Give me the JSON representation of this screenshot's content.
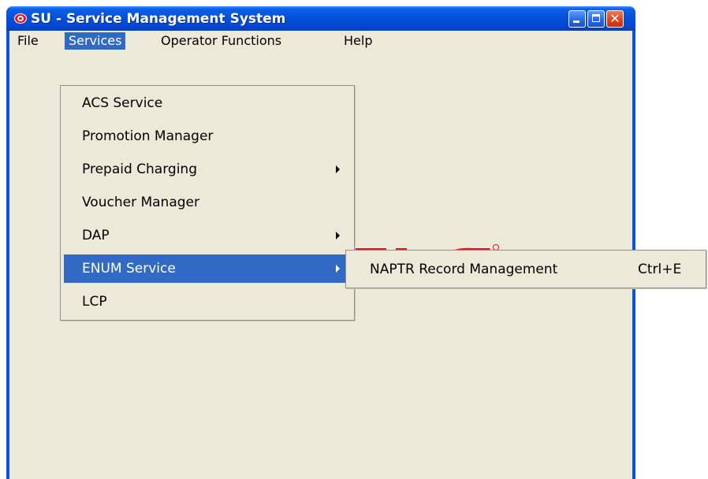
{
  "window": {
    "title": "SU - Service Management System"
  },
  "menubar": {
    "items": [
      {
        "label": "File"
      },
      {
        "label": "Services"
      },
      {
        "label": "Operator Functions"
      },
      {
        "label": "Help"
      }
    ]
  },
  "services_menu": {
    "items": [
      {
        "label": "ACS Service",
        "submenu": false
      },
      {
        "label": "Promotion Manager",
        "submenu": false
      },
      {
        "label": "Prepaid Charging",
        "submenu": true
      },
      {
        "label": "Voucher Manager",
        "submenu": false
      },
      {
        "label": "DAP",
        "submenu": true
      },
      {
        "label": "ENUM Service",
        "submenu": true,
        "highlighted": true
      },
      {
        "label": "LCP",
        "submenu": false
      }
    ]
  },
  "enum_submenu": {
    "items": [
      {
        "label": "NAPTR Record Management",
        "shortcut": "Ctrl+E"
      }
    ]
  },
  "colors": {
    "titlebar": "#0450d8",
    "menu_highlight": "#316ac5",
    "window_bg": "#ece9d8",
    "logo_red": "#e8101a"
  }
}
